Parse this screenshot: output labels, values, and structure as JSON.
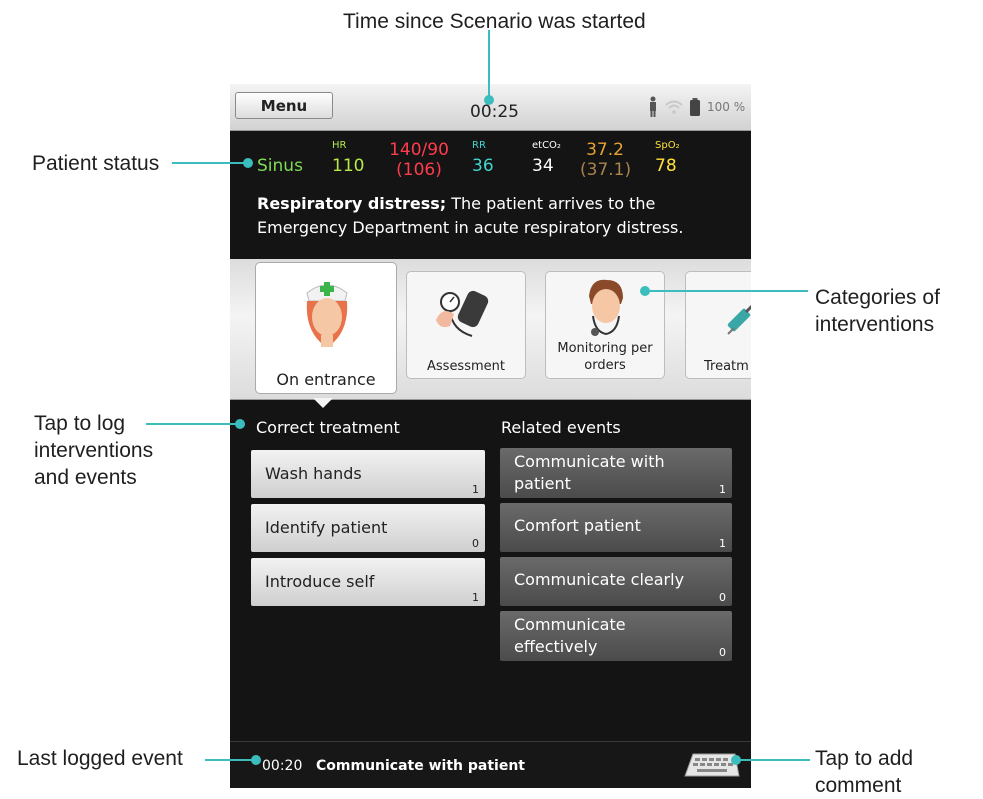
{
  "annotations": {
    "time_since_start": "Time since Scenario was started",
    "patient_status": "Patient status",
    "categories": "Categories of\ninterventions",
    "tap_to_log": "Tap to log\ninterventions\nand events",
    "last_logged": "Last logged event",
    "tap_comment": "Tap to add\ncomment"
  },
  "topbar": {
    "menu_label": "Menu",
    "timer": "00:25",
    "battery_pct": "100 %"
  },
  "vitals": {
    "rhythm": "Sinus",
    "hr_label": "HR",
    "hr_value": "110",
    "bp_value": "140/90",
    "bp_mean": "(106)",
    "rr_label": "RR",
    "rr_value": "36",
    "etco2_label": "etCO₂",
    "etco2_value": "34",
    "temp_value": "37.2",
    "temp_sub": "(37.1)",
    "spo2_label": "SpO₂",
    "spo2_value": "78"
  },
  "description": {
    "title": "Respiratory distress;",
    "text": " The patient arrives to the Emergency Department in acute respiratory distress."
  },
  "categories": [
    {
      "label": "On entrance",
      "icon": "nurse-icon",
      "active": true
    },
    {
      "label": "Assessment",
      "icon": "blood-pressure-icon",
      "active": false
    },
    {
      "label": "Monitoring per orders",
      "icon": "doctor-stethoscope-icon",
      "active": false
    },
    {
      "label": "Treatm",
      "icon": "syringe-icon",
      "active": false
    }
  ],
  "correct_treatment": {
    "heading": "Correct treatment",
    "items": [
      {
        "label": "Wash hands",
        "count": "1"
      },
      {
        "label": "Identify patient",
        "count": "0"
      },
      {
        "label": "Introduce self",
        "count": "1"
      }
    ]
  },
  "related_events": {
    "heading": "Related events",
    "items": [
      {
        "label": "Communicate with patient",
        "count": "1"
      },
      {
        "label": "Comfort patient",
        "count": "1"
      },
      {
        "label": "Communicate clearly",
        "count": "0"
      },
      {
        "label": "Communicate effectively",
        "count": "0"
      }
    ]
  },
  "bottombar": {
    "time": "00:20",
    "event": "Communicate with patient",
    "comment_icon": "keyboard-icon"
  },
  "colors": {
    "leader": "#3bbdbd",
    "sinus": "#7fdc55",
    "hr": "#b6ea4a",
    "bp": "#ff3c4c",
    "rr": "#43d6cf",
    "etco2": "#ffffff",
    "temp": "#e7a332",
    "spo2": "#ffe23a"
  }
}
